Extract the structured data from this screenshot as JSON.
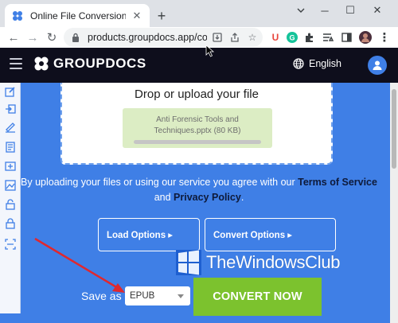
{
  "browser": {
    "tab_title": "Online File Conversion | Free Gro",
    "url": "products.groupdocs.app/conv...",
    "new_tab_label": "+",
    "close_label": "✕",
    "minimize_label": "─",
    "maximize_label": "☐",
    "window_close_label": "✕",
    "back_label": "←",
    "forward_label": "→",
    "reload_label": "↻",
    "extension_u": "U",
    "extension_g": "G",
    "menu_label": "⋮"
  },
  "site": {
    "logo_text": "GROUPDOCS",
    "language": "English",
    "drop_title": "Drop or upload your file",
    "file_name_line1": "Anti Forensic Tools and",
    "file_name_line2": "Techniques.pptx (80 KB)",
    "agree_prefix": "By uploading your files or using our service you agree with our ",
    "terms_link": "Terms of Service",
    "agree_and": "and ",
    "privacy_link": "Privacy Policy",
    "agree_end": ".",
    "load_options": "Load Options ▸",
    "convert_options": "Convert Options ▸",
    "save_as": "Save as",
    "format": "EPUB",
    "convert_button": "CONVERT NOW"
  },
  "watermark": {
    "text": "TheWindowsClub"
  },
  "colors": {
    "site_bg": "#3f7fe6",
    "header_bg": "#0e0e1c",
    "convert_green": "#7cc22e",
    "arrow_red": "#e0282e"
  }
}
